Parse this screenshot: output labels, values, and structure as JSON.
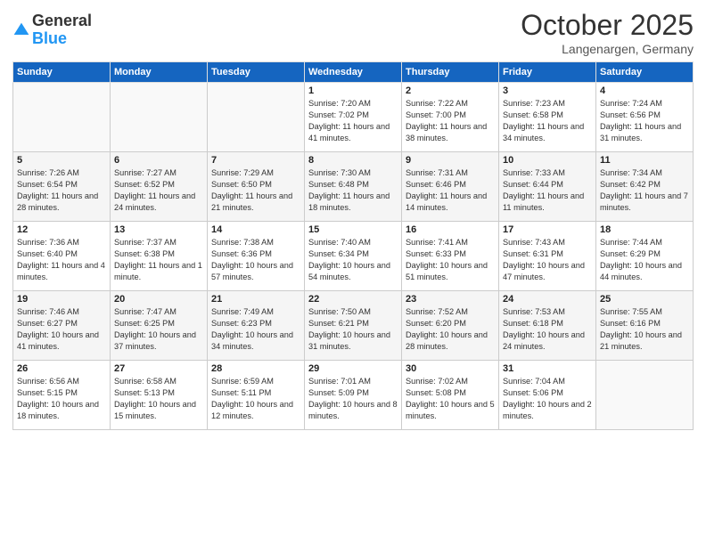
{
  "header": {
    "logo_general": "General",
    "logo_blue": "Blue",
    "month": "October 2025",
    "location": "Langenargen, Germany"
  },
  "days_of_week": [
    "Sunday",
    "Monday",
    "Tuesday",
    "Wednesday",
    "Thursday",
    "Friday",
    "Saturday"
  ],
  "weeks": [
    [
      {
        "day": "",
        "info": ""
      },
      {
        "day": "",
        "info": ""
      },
      {
        "day": "",
        "info": ""
      },
      {
        "day": "1",
        "info": "Sunrise: 7:20 AM\nSunset: 7:02 PM\nDaylight: 11 hours and 41 minutes."
      },
      {
        "day": "2",
        "info": "Sunrise: 7:22 AM\nSunset: 7:00 PM\nDaylight: 11 hours and 38 minutes."
      },
      {
        "day": "3",
        "info": "Sunrise: 7:23 AM\nSunset: 6:58 PM\nDaylight: 11 hours and 34 minutes."
      },
      {
        "day": "4",
        "info": "Sunrise: 7:24 AM\nSunset: 6:56 PM\nDaylight: 11 hours and 31 minutes."
      }
    ],
    [
      {
        "day": "5",
        "info": "Sunrise: 7:26 AM\nSunset: 6:54 PM\nDaylight: 11 hours and 28 minutes."
      },
      {
        "day": "6",
        "info": "Sunrise: 7:27 AM\nSunset: 6:52 PM\nDaylight: 11 hours and 24 minutes."
      },
      {
        "day": "7",
        "info": "Sunrise: 7:29 AM\nSunset: 6:50 PM\nDaylight: 11 hours and 21 minutes."
      },
      {
        "day": "8",
        "info": "Sunrise: 7:30 AM\nSunset: 6:48 PM\nDaylight: 11 hours and 18 minutes."
      },
      {
        "day": "9",
        "info": "Sunrise: 7:31 AM\nSunset: 6:46 PM\nDaylight: 11 hours and 14 minutes."
      },
      {
        "day": "10",
        "info": "Sunrise: 7:33 AM\nSunset: 6:44 PM\nDaylight: 11 hours and 11 minutes."
      },
      {
        "day": "11",
        "info": "Sunrise: 7:34 AM\nSunset: 6:42 PM\nDaylight: 11 hours and 7 minutes."
      }
    ],
    [
      {
        "day": "12",
        "info": "Sunrise: 7:36 AM\nSunset: 6:40 PM\nDaylight: 11 hours and 4 minutes."
      },
      {
        "day": "13",
        "info": "Sunrise: 7:37 AM\nSunset: 6:38 PM\nDaylight: 11 hours and 1 minute."
      },
      {
        "day": "14",
        "info": "Sunrise: 7:38 AM\nSunset: 6:36 PM\nDaylight: 10 hours and 57 minutes."
      },
      {
        "day": "15",
        "info": "Sunrise: 7:40 AM\nSunset: 6:34 PM\nDaylight: 10 hours and 54 minutes."
      },
      {
        "day": "16",
        "info": "Sunrise: 7:41 AM\nSunset: 6:33 PM\nDaylight: 10 hours and 51 minutes."
      },
      {
        "day": "17",
        "info": "Sunrise: 7:43 AM\nSunset: 6:31 PM\nDaylight: 10 hours and 47 minutes."
      },
      {
        "day": "18",
        "info": "Sunrise: 7:44 AM\nSunset: 6:29 PM\nDaylight: 10 hours and 44 minutes."
      }
    ],
    [
      {
        "day": "19",
        "info": "Sunrise: 7:46 AM\nSunset: 6:27 PM\nDaylight: 10 hours and 41 minutes."
      },
      {
        "day": "20",
        "info": "Sunrise: 7:47 AM\nSunset: 6:25 PM\nDaylight: 10 hours and 37 minutes."
      },
      {
        "day": "21",
        "info": "Sunrise: 7:49 AM\nSunset: 6:23 PM\nDaylight: 10 hours and 34 minutes."
      },
      {
        "day": "22",
        "info": "Sunrise: 7:50 AM\nSunset: 6:21 PM\nDaylight: 10 hours and 31 minutes."
      },
      {
        "day": "23",
        "info": "Sunrise: 7:52 AM\nSunset: 6:20 PM\nDaylight: 10 hours and 28 minutes."
      },
      {
        "day": "24",
        "info": "Sunrise: 7:53 AM\nSunset: 6:18 PM\nDaylight: 10 hours and 24 minutes."
      },
      {
        "day": "25",
        "info": "Sunrise: 7:55 AM\nSunset: 6:16 PM\nDaylight: 10 hours and 21 minutes."
      }
    ],
    [
      {
        "day": "26",
        "info": "Sunrise: 6:56 AM\nSunset: 5:15 PM\nDaylight: 10 hours and 18 minutes."
      },
      {
        "day": "27",
        "info": "Sunrise: 6:58 AM\nSunset: 5:13 PM\nDaylight: 10 hours and 15 minutes."
      },
      {
        "day": "28",
        "info": "Sunrise: 6:59 AM\nSunset: 5:11 PM\nDaylight: 10 hours and 12 minutes."
      },
      {
        "day": "29",
        "info": "Sunrise: 7:01 AM\nSunset: 5:09 PM\nDaylight: 10 hours and 8 minutes."
      },
      {
        "day": "30",
        "info": "Sunrise: 7:02 AM\nSunset: 5:08 PM\nDaylight: 10 hours and 5 minutes."
      },
      {
        "day": "31",
        "info": "Sunrise: 7:04 AM\nSunset: 5:06 PM\nDaylight: 10 hours and 2 minutes."
      },
      {
        "day": "",
        "info": ""
      }
    ]
  ]
}
